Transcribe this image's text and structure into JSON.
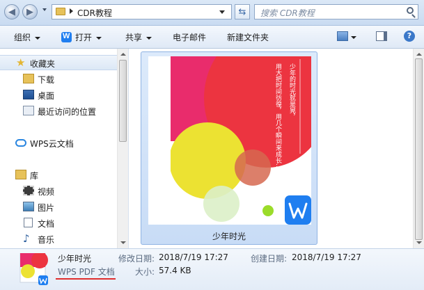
{
  "address": {
    "path_segment": "CDR教程",
    "search_placeholder": "搜索 CDR教程"
  },
  "toolbar": {
    "organize": "组织",
    "open": "打开",
    "share": "共享",
    "email": "电子邮件",
    "new_folder": "新建文件夹"
  },
  "nav": {
    "favorites": "收藏夹",
    "downloads": "下载",
    "desktop": "桌面",
    "recent": "最近访问的位置",
    "wps_cloud": "WPS云文档",
    "library": "库",
    "videos": "视频",
    "pictures": "图片",
    "documents": "文档",
    "music": "音乐"
  },
  "file": {
    "name": "少年时光",
    "thumb_text_1": "少年的时光就是晃，",
    "thumb_text_2": "用大把时间彷徨，用几个瞬间来成长…"
  },
  "details": {
    "name": "少年时光",
    "type": "WPS PDF 文档",
    "modified_label": "修改日期:",
    "modified_value": "2018/7/19 17:27",
    "created_label": "创建日期:",
    "created_value": "2018/7/19 17:27",
    "size_label": "大小:",
    "size_value": "57.4 KB"
  },
  "colors": {
    "accent_red": "#e02d2d",
    "wps_blue": "#1f7ef0",
    "selection": "#cfe0f7"
  }
}
